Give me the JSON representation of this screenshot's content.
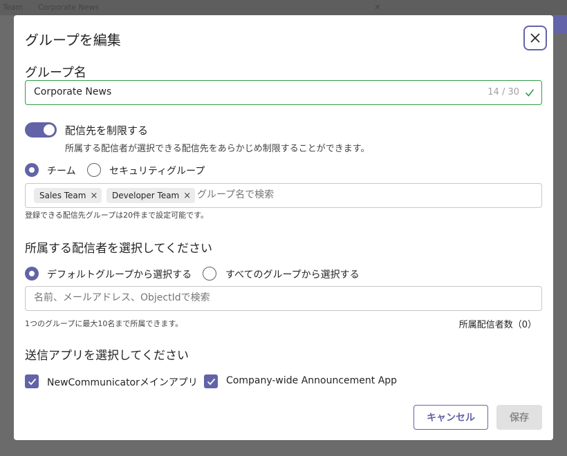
{
  "backdrop": {
    "tab1": "Team",
    "tab2": "Corporate News",
    "close_glyph": "×"
  },
  "dialog": {
    "title": "グループを編集",
    "close_icon": "close-icon",
    "group_name": {
      "label": "グループ名",
      "value": "Corporate News",
      "counter": "14 / 30",
      "status_icon": "checkmark-icon"
    },
    "restrict": {
      "enabled": true,
      "label": "配信先を制限する",
      "description": "所属する配信者が選択できる配信先をあらかじめ制限することができます。"
    },
    "target_type": {
      "options": [
        "チーム",
        "セキュリティグループ"
      ],
      "selected": "チーム"
    },
    "target_tags": {
      "tags": [
        "Sales Team",
        "Developer Team"
      ],
      "remove_glyph": "×",
      "placeholder": "グループ名で検索",
      "hint": "登録できる配信先グループは20件まで設定可能です。"
    },
    "members": {
      "section_title": "所属する配信者を選択してください",
      "options": [
        "デフォルトグループから選択する",
        "すべてのグループから選択する"
      ],
      "selected": "デフォルトグループから選択する",
      "search_placeholder": "名前、メールアドレス、ObjectIdで検索",
      "hint": "1つのグループに最大10名まで所属できます。",
      "count_label": "所属配信者数（0）"
    },
    "apps": {
      "section_title": "送信アプリを選択してください",
      "items": [
        {
          "label": "NewCommunicatorメインアプリ",
          "checked": true
        },
        {
          "label": "Company-wide Announcement App",
          "checked": true
        }
      ]
    },
    "buttons": {
      "cancel": "キャンセル",
      "save": "保存"
    }
  },
  "colors": {
    "accent": "#6264a7",
    "success": "#2f9e44",
    "disabled_bg": "#e1e1e1"
  }
}
